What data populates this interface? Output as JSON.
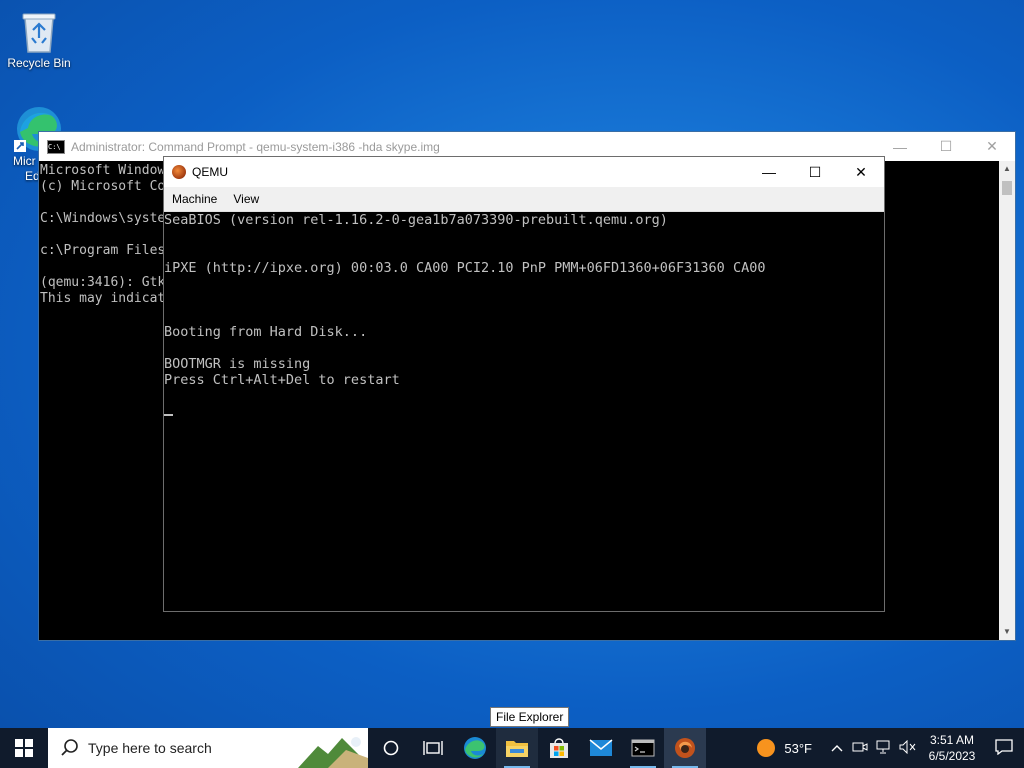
{
  "desktop": {
    "recycle_bin_label": "Recycle Bin",
    "edge_label_line1": "Micr",
    "edge_label_line2": "Ed"
  },
  "cmd_window": {
    "title": "Administrator: Command Prompt - qemu-system-i386  -hda skype.img",
    "icon_text": "C:\\",
    "lines": [
      "Microsoft Windows",
      "(c) Microsoft Co",
      "",
      "C:\\Windows\\syste",
      "",
      "c:\\Program Files",
      "",
      "(qemu:3416): Gtk",
      "This may indicat"
    ],
    "minimize_glyph": "—",
    "maximize_glyph": "☐",
    "close_glyph": "✕"
  },
  "qemu_window": {
    "title": "QEMU",
    "menu": [
      "Machine",
      "View"
    ],
    "minimize_glyph": "—",
    "maximize_glyph": "☐",
    "close_glyph": "✕",
    "screen_lines": [
      "SeaBIOS (version rel-1.16.2-0-gea1b7a073390-prebuilt.qemu.org)",
      "",
      "",
      "iPXE (http://ipxe.org) 00:03.0 CA00 PCI2.10 PnP PMM+06FD1360+06F31360 CA00",
      "",
      "",
      "",
      "Booting from Hard Disk...",
      "",
      "BOOTMGR is missing",
      "Press Ctrl+Alt+Del to restart",
      ""
    ]
  },
  "tooltip": "File Explorer",
  "taskbar": {
    "search_placeholder": "Type here to search",
    "pinned": [
      {
        "name": "cortana-icon"
      },
      {
        "name": "task-view-icon"
      },
      {
        "name": "edge-icon"
      },
      {
        "name": "file-explorer-icon"
      },
      {
        "name": "store-icon"
      },
      {
        "name": "mail-icon"
      },
      {
        "name": "terminal-icon"
      },
      {
        "name": "qemu-icon"
      }
    ],
    "weather_temp": "53°F",
    "time": "3:51 AM",
    "date": "6/5/2023"
  },
  "colors": {
    "accent": "#0078d7",
    "taskbar": "#101b2c",
    "console_text": "#c0c0c0"
  }
}
